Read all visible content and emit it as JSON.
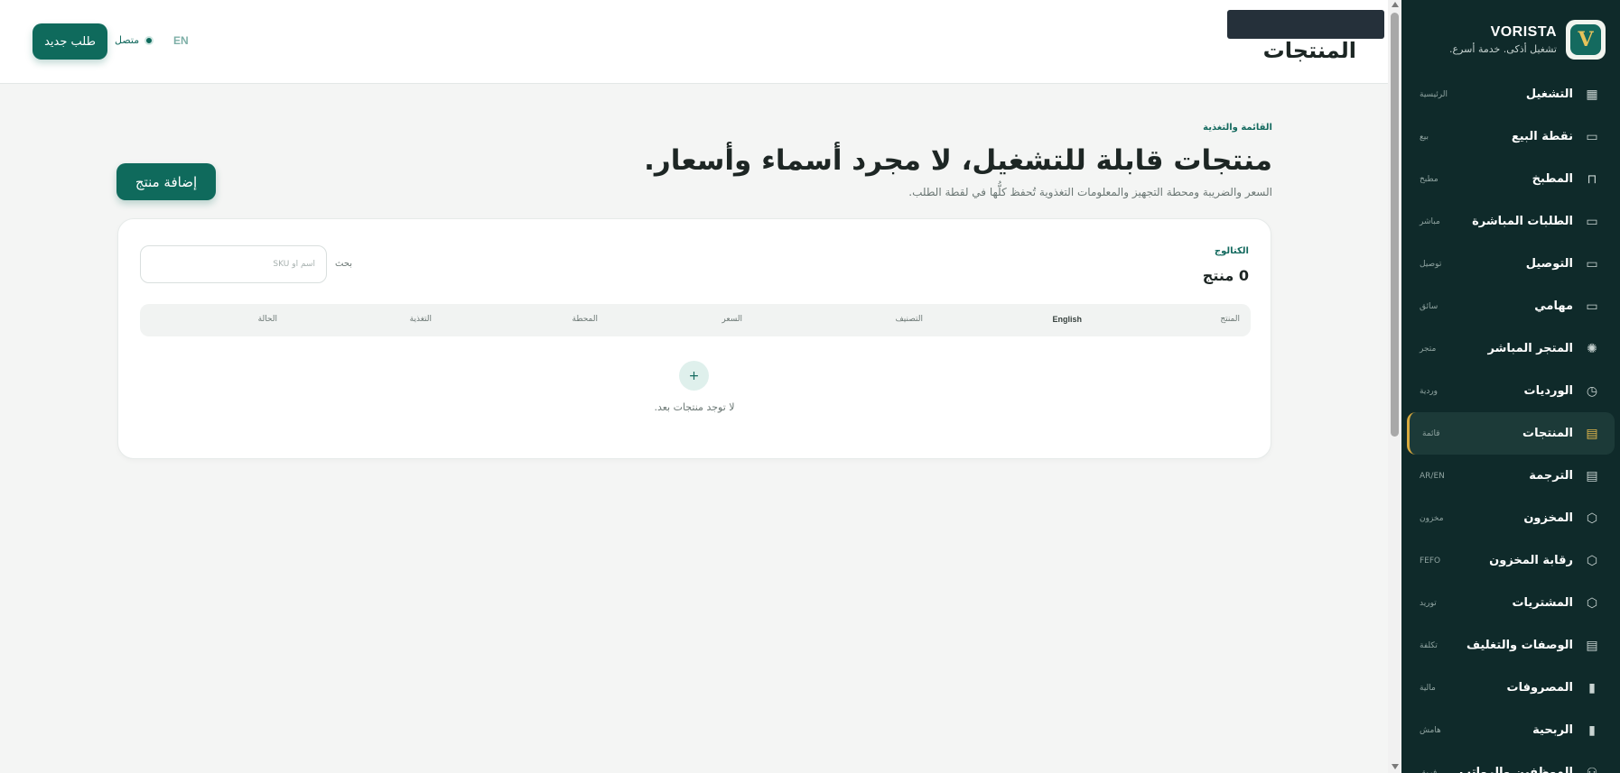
{
  "header": {
    "title": "المنتجات",
    "new_order_label": "طلب جديد",
    "status_label": "متصل",
    "lang_label": "EN"
  },
  "sidebar": {
    "brand_name": "VORISTA",
    "brand_tagline": "تشغيل أذكى. خدمة أسرع.",
    "items": [
      {
        "label": "التشغيل",
        "sub": "الرئيسية",
        "icon": "dashboard-icon"
      },
      {
        "label": "نقطة البيع",
        "sub": "بيع",
        "icon": "store-icon"
      },
      {
        "label": "المطبخ",
        "sub": "مطبخ",
        "icon": "bag-icon"
      },
      {
        "label": "الطلبات المباشرة",
        "sub": "مباشر",
        "icon": "store-icon"
      },
      {
        "label": "التوصيل",
        "sub": "توصيل",
        "icon": "monitor-icon"
      },
      {
        "label": "مهامي",
        "sub": "سائق",
        "icon": "monitor-icon"
      },
      {
        "label": "المتجر المباشر",
        "sub": "متجر",
        "icon": "sun-icon"
      },
      {
        "label": "الورديات",
        "sub": "وردية",
        "icon": "clock-icon"
      },
      {
        "label": "المنتجات",
        "sub": "قائمة",
        "icon": "clipboard-icon",
        "active": true
      },
      {
        "label": "الترجمة",
        "sub": "AR/EN",
        "icon": "clipboard-icon"
      },
      {
        "label": "المخزون",
        "sub": "مخزون",
        "icon": "box-icon"
      },
      {
        "label": "رقابة المخزون",
        "sub": "FEFO",
        "icon": "box-icon"
      },
      {
        "label": "المشتريات",
        "sub": "توريد",
        "icon": "box-icon"
      },
      {
        "label": "الوصفات والتغليف",
        "sub": "تكلفة",
        "icon": "clipboard-icon"
      },
      {
        "label": "المصروفات",
        "sub": "مالية",
        "icon": "bar-chart-icon"
      },
      {
        "label": "الربحية",
        "sub": "هامش",
        "icon": "bar-chart-icon"
      },
      {
        "label": "الموظفين والرواتب",
        "sub": "فريق",
        "icon": "users-icon"
      }
    ]
  },
  "main": {
    "eyebrow": "القائمة والتغذية",
    "title": "منتجات قابلة للتشغيل، لا مجرد أسماء وأسعار.",
    "subtitle": "السعر والضريبة ومحطة التجهيز والمعلومات التغذوية تُحفظ كلُّها في لقطة الطلب.",
    "add_product_label": "إضافة منتج"
  },
  "catalog": {
    "label": "الكتالوج",
    "count": "0 منتج",
    "search_label": "بحث",
    "search_placeholder": "اسم أو SKU",
    "search_value": "",
    "columns": [
      "المنتج",
      "English",
      "التصنيف",
      "السعر",
      "المحطة",
      "التغذية",
      "الحالة"
    ],
    "empty_icon": "+",
    "empty_text": "لا توجد منتجات بعد."
  }
}
